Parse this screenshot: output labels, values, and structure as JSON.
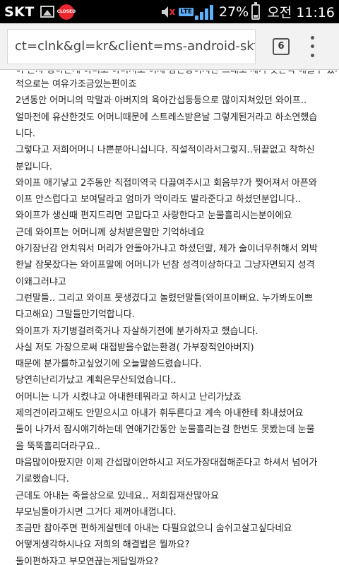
{
  "status_bar": {
    "carrier": "SKT",
    "app_badge": "CLOSED",
    "network": "LTE",
    "battery_percent": "27%",
    "time": "오전 11:16",
    "icons": [
      "image-icon",
      "app-icon",
      "mute-icon",
      "signal-icon",
      "battery-icon"
    ]
  },
  "browser": {
    "url": "ct=clnk&gl=kr&client=ms-android-skt-kr",
    "tab_count": "6"
  },
  "article": {
    "partial_line": "이 혼자 상하는게 아니고 아버지도 이제 참는중이지만 그래도 제가 못본척 해줄수 있지 경제",
    "lines": [
      "적으로는 여유가조금있는편이죠",
      "2년동안 어머니의 막말과 아버지의 육아간섭등등으로 많이지쳐있던 와이프..",
      "얼마전에 유산한것도 어머니때문에 스트레스받은날 그렇게된거라고 하소연했습",
      "니다.",
      "그렇다고 저희어머니 나쁜분아니십니다. 직설적이라서그렇지..뒤끝없고 착하신",
      "분입니다.",
      "와이프 애기낳고 2주동안 직접미역국 다끓여주시고 회음부?가 찢어져서 아픈와",
      "이프 안스럽다고 보여달라고 엄마가 약이라도 발라준다고 하셨던분입니다..",
      "와이프가 생신때 편지드리면 고맙다고 사랑한다고 눈물흘리시는분이에요",
      "근데 와이프는 어머니께 상처받은말만 기억하네요",
      "아기장난감 안치워서 머리가 안돌아가냐고 하셨던말, 제가 술이너무취해서 외박",
      "한날 잠못잤다는 와이프말에 어머니가 넌참 성격이상하다고 그냥자면되지 성격",
      "이왜그러냐고",
      "그런말들.. 그리고 와이프 못생겼다고 놀렸던말들(와이프이뻐요. 누가봐도이쁘",
      "다고해요) 그말들만기억합니다.",
      "와이프가 자기병걸려죽거나 자살하기전에 분가하자고 했습니다.",
      "사실 저도 가장으로써 대접받을수없는환경( 가부장적인아버지)",
      "때문에 분가를하고싶었기에 오늘말씀드렸습니다.",
      "당연히난리가났고 계획은무산되었습니다..",
      "어머니는 니가 시켰냐고 아내한테뭐라고 하시고 난리가났죠",
      "제의견이라고해도 안믿으시고 아내가 휘두른다고 계속 아내한테 화내셨어요",
      "둘이 나가서 잠시얘기하는데 연애기간동안 눈물흘리는걸 한번도 못봤는데 눈물",
      "을 뚝뚝흘리더라구요..",
      "마음많이아팠지만 이제 간섭많이안하시고 저도가장대접해준다고 하셔서 넘어가",
      "기로했습니다.",
      "근데도 아내는 죽을상으로 있네요.. 저희집재산많아요",
      "부모님돌아가시면 그거다 제꺼아내껍니다.",
      "조금만 참아주면 편하게살텐데 아내는 다필요없으니 숨쉬고살고싶다네요",
      "어떻게생각하시나요 저희의 해결법은 뭘까요?",
      "둘이편하자고 부모연끊는게답일까요?"
    ]
  }
}
